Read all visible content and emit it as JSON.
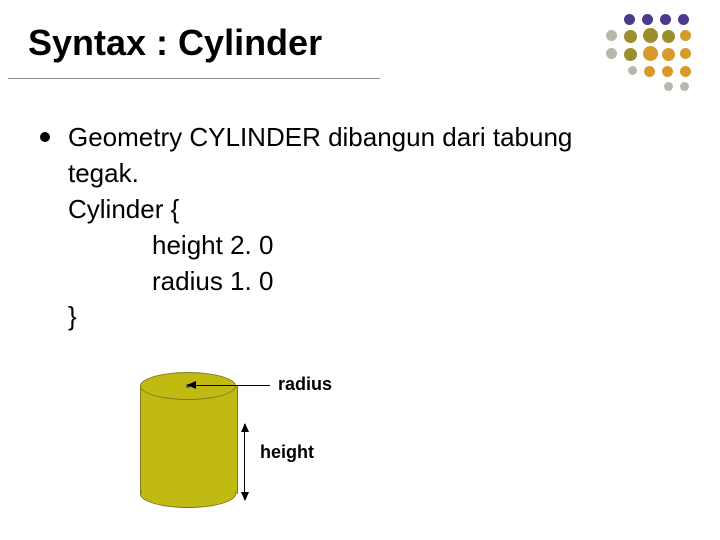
{
  "title": "Syntax : Cylinder",
  "bullet": {
    "line1": "Geometry CYLINDER dibangun dari tabung",
    "line2": "tegak.",
    "code_open": "Cylinder {",
    "code_height": "height 2. 0",
    "code_radius": "radius 1. 0",
    "code_close": "}"
  },
  "diagram": {
    "radius_label": "radius",
    "height_label": "height"
  },
  "decor": {
    "palette": {
      "purple": "#4b3a8f",
      "olive": "#9a8f2d",
      "orange": "#d89a2a",
      "grey": "#b7b7ad"
    }
  }
}
